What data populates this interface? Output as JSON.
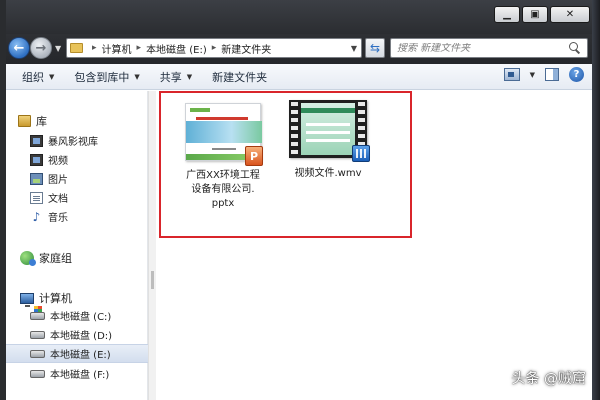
{
  "window": {
    "minimize": "▁",
    "maximize": "▣",
    "close": "✕"
  },
  "address": {
    "crumbs": [
      "计算机",
      "本地磁盘 (E:)",
      "新建文件夹"
    ],
    "search_placeholder": "搜索 新建文件夹"
  },
  "toolbar": {
    "organize": "组织",
    "include_in_library": "包含到库中",
    "share": "共享",
    "new_folder": "新建文件夹"
  },
  "nav": {
    "libraries": "库",
    "library_items": [
      "暴风影视库",
      "视频",
      "图片",
      "文档",
      "音乐"
    ],
    "homegroup": "家庭组",
    "computer": "计算机",
    "drives": [
      "本地磁盘 (C:)",
      "本地磁盘 (D:)",
      "本地磁盘 (E:)",
      "本地磁盘 (F:)"
    ],
    "selected_drive": "本地磁盘 (E:)"
  },
  "files": [
    {
      "name_line1": "广西XX环境工程",
      "name_line2": "设备有限公司.",
      "name_line3": "pptx",
      "type": "pptx"
    },
    {
      "name_line1": "视频文件.wmv",
      "type": "wmv"
    }
  ],
  "watermark": "头条 @贼窟",
  "colors": {
    "highlight_box": "#d9252b",
    "nav_selected": "#d3deee"
  }
}
